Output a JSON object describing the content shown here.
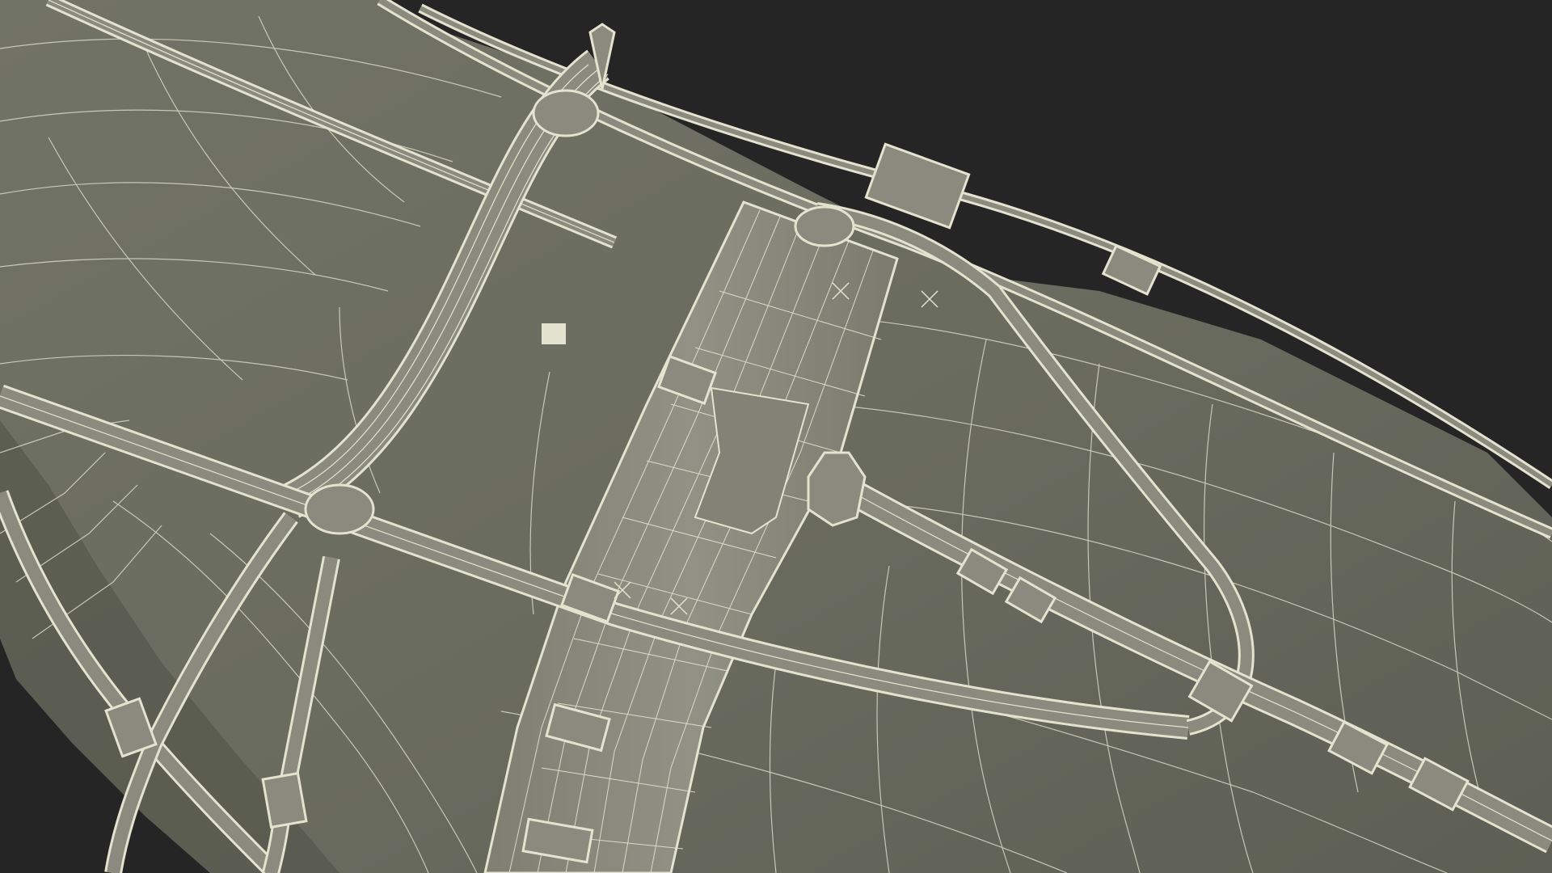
{
  "scene": {
    "subject": "wireframe-render",
    "colors": {
      "background": "#252525",
      "surface": "#6c6d61",
      "surface_shadow": "#55574c",
      "wire": "#d9d8c4",
      "strap": "#8a8b7e",
      "strap_edge": "#e4e3cf"
    }
  }
}
